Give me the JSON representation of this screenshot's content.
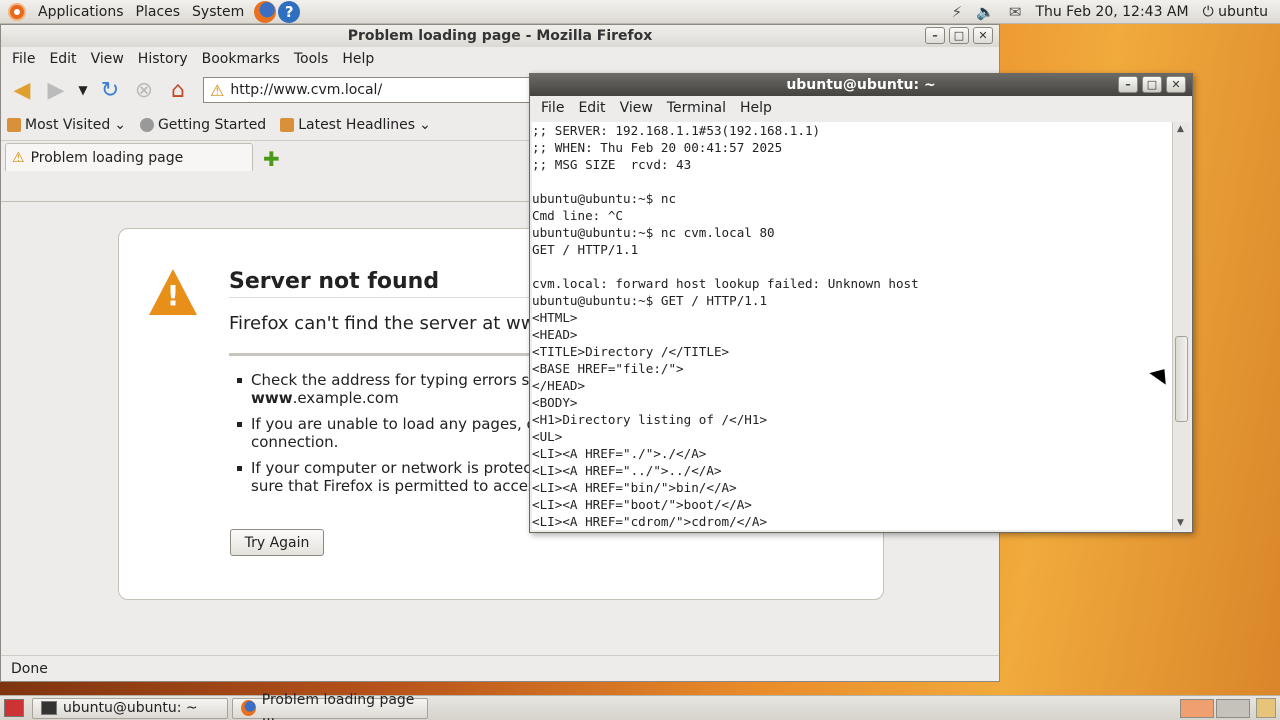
{
  "top_panel": {
    "menus": [
      "Applications",
      "Places",
      "System"
    ],
    "clock": "Thu Feb 20, 12:43 AM",
    "user": "ubuntu"
  },
  "firefox": {
    "title": "Problem loading page - Mozilla Firefox",
    "menu": [
      "File",
      "Edit",
      "View",
      "History",
      "Bookmarks",
      "Tools",
      "Help"
    ],
    "url": "http://www.cvm.local/",
    "bookmarks": [
      "Most Visited",
      "Getting Started",
      "Latest Headlines"
    ],
    "tab_title": "Problem loading page",
    "error": {
      "title": "Server not found",
      "description": "Firefox can't find the server at ww",
      "items": [
        {
          "line1": "Check the address for typing errors su",
          "line2_bold": "www",
          "line2_rest": ".example.com"
        },
        {
          "line1": "If you are unable to load any pages, c",
          "line2": "connection."
        },
        {
          "line1": "If your computer or network is protect",
          "line2": "sure that Firefox is permitted to acces"
        }
      ],
      "button": "Try Again"
    },
    "status": "Done"
  },
  "terminal": {
    "title": "ubuntu@ubuntu: ~",
    "menu": [
      "File",
      "Edit",
      "View",
      "Terminal",
      "Help"
    ],
    "lines": [
      ";; SERVER: 192.168.1.1#53(192.168.1.1)",
      ";; WHEN: Thu Feb 20 00:41:57 2025",
      ";; MSG SIZE  rcvd: 43",
      "",
      "ubuntu@ubuntu:~$ nc",
      "Cmd line: ^C",
      "ubuntu@ubuntu:~$ nc cvm.local 80",
      "GET / HTTP/1.1",
      "",
      "cvm.local: forward host lookup failed: Unknown host",
      "ubuntu@ubuntu:~$ GET / HTTP/1.1",
      "<HTML>",
      "<HEAD>",
      "<TITLE>Directory /</TITLE>",
      "<BASE HREF=\"file:/\">",
      "</HEAD>",
      "<BODY>",
      "<H1>Directory listing of /</H1>",
      "<UL>",
      "<LI><A HREF=\"./\">./</A>",
      "<LI><A HREF=\"../\">../</A>",
      "<LI><A HREF=\"bin/\">bin/</A>",
      "<LI><A HREF=\"boot/\">boot/</A>",
      "<LI><A HREF=\"cdrom/\">cdrom/</A>"
    ]
  },
  "taskbar": {
    "tasks": [
      "ubuntu@ubuntu: ~",
      "Problem loading page ..."
    ]
  }
}
